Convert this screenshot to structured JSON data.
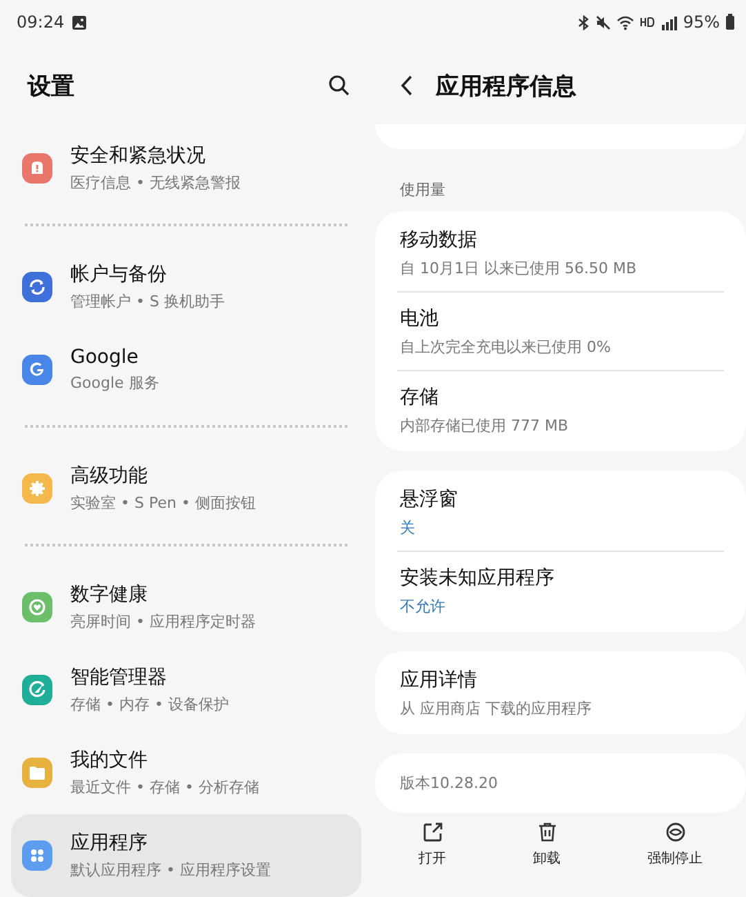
{
  "status_bar": {
    "time": "09:24",
    "battery": "95%"
  },
  "settings": {
    "title": "设置",
    "groups": [
      {
        "items": [
          {
            "title": "安全和紧急状况",
            "subtitle": "医疗信息 • 无线紧急警报",
            "color": "#e8766b",
            "selected": false
          }
        ]
      },
      {
        "items": [
          {
            "title": "帐户与备份",
            "subtitle": "管理帐户 • S 换机助手",
            "color": "#3f6fd8",
            "selected": false
          },
          {
            "title": "Google",
            "subtitle": "Google 服务",
            "color": "#4a86e8",
            "selected": false
          }
        ]
      },
      {
        "items": [
          {
            "title": "高级功能",
            "subtitle": "实验室 • S Pen • 侧面按钮",
            "color": "#f5b84a",
            "selected": false
          }
        ]
      },
      {
        "items": [
          {
            "title": "数字健康",
            "subtitle": "亮屏时间 • 应用程序定时器",
            "color": "#6cbf6a",
            "selected": false
          },
          {
            "title": "智能管理器",
            "subtitle": "存储 • 内存 • 设备保护",
            "color": "#1fae98",
            "selected": false
          },
          {
            "title": "我的文件",
            "subtitle": "最近文件 • 存储 • 分析存储",
            "color": "#e6b13f",
            "selected": false
          },
          {
            "title": "应用程序",
            "subtitle": "默认应用程序 • 应用程序设置",
            "color": "#5c9df0",
            "selected": true
          }
        ]
      }
    ]
  },
  "app_info": {
    "title": "应用程序信息",
    "sections": [
      {
        "label": "使用量",
        "items": [
          {
            "title": "移动数据",
            "summary": "自 10月1日 以来已使用 56.50 MB"
          },
          {
            "title": "电池",
            "summary": "自上次完全充电以来已使用 0%"
          },
          {
            "title": "存储",
            "summary": "内部存储已使用 777 MB"
          }
        ]
      },
      {
        "items": [
          {
            "title": "悬浮窗",
            "value": "关"
          },
          {
            "title": "安装未知应用程序",
            "value": "不允许"
          }
        ]
      },
      {
        "items": [
          {
            "title": "应用详情",
            "summary": "从 应用商店 下载的应用程序"
          }
        ]
      },
      {
        "items": [
          {
            "summary": "版本10.28.20"
          }
        ]
      }
    ],
    "actions": [
      {
        "label": "打开"
      },
      {
        "label": "卸载"
      },
      {
        "label": "强制停止"
      }
    ]
  }
}
